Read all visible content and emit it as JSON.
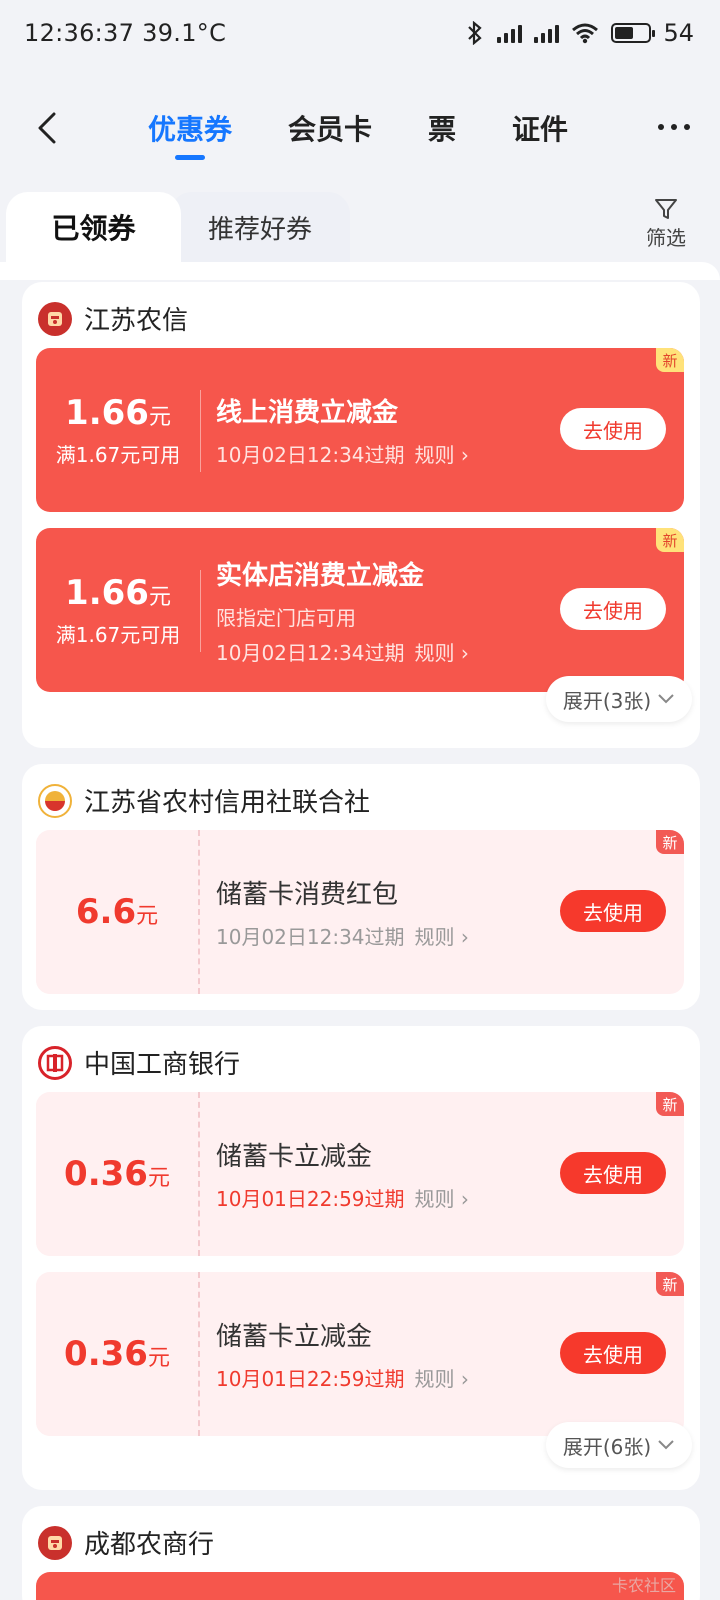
{
  "status": {
    "time": "12:36:37",
    "temp": "39.1°C",
    "battery": "54"
  },
  "nav": {
    "tabs": [
      {
        "label": "优惠券",
        "active": true
      },
      {
        "label": "会员卡",
        "active": false
      },
      {
        "label": "票",
        "active": false
      },
      {
        "label": "证件",
        "active": false
      }
    ]
  },
  "segment": {
    "active": "已领券",
    "inactive": "推荐好券",
    "filter": "筛选"
  },
  "groups": [
    {
      "name": "江苏农信",
      "coupons": [
        {
          "amount": "1.66",
          "unit": "元",
          "cond": "满1.67元可用",
          "title": "线上消费立减金",
          "sub": "",
          "expire": "10月02日12:34过期",
          "rule": "规则 ›",
          "btn": "去使用",
          "badge": "新"
        },
        {
          "amount": "1.66",
          "unit": "元",
          "cond": "满1.67元可用",
          "title": "实体店消费立减金",
          "sub": "限指定门店可用",
          "expire": "10月02日12:34过期",
          "rule": "规则 ›",
          "btn": "去使用",
          "badge": "新"
        }
      ],
      "expand": "展开(3张)"
    },
    {
      "name": "江苏省农村信用社联合社",
      "coupons": [
        {
          "amount": "6.6",
          "unit": "元",
          "title": "储蓄卡消费红包",
          "expire": "10月02日12:34过期",
          "rule": "规则 ›",
          "btn": "去使用",
          "badge": "新"
        }
      ]
    },
    {
      "name": "中国工商银行",
      "coupons": [
        {
          "amount": "0.36",
          "unit": "元",
          "title": "储蓄卡立减金",
          "expire": "10月01日22:59过期",
          "rule": "规则 ›",
          "btn": "去使用",
          "badge": "新"
        },
        {
          "amount": "0.36",
          "unit": "元",
          "title": "储蓄卡立减金",
          "expire": "10月01日22:59过期",
          "rule": "规则 ›",
          "btn": "去使用",
          "badge": "新"
        }
      ],
      "expand": "展开(6张)"
    },
    {
      "name": "成都农商行"
    }
  ],
  "watermark": "卡农社区"
}
